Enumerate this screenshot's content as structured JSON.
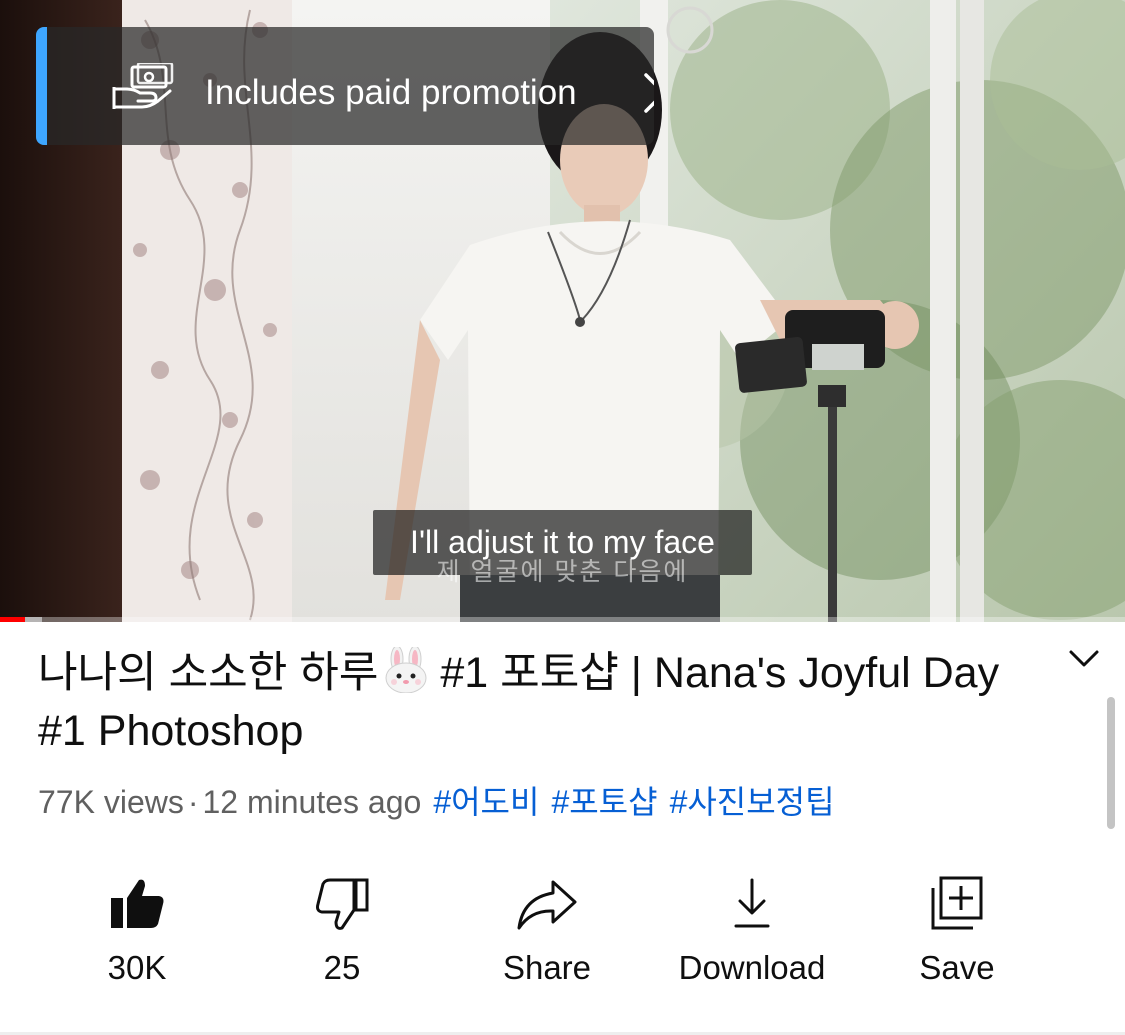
{
  "player": {
    "promo_label": "Includes paid promotion",
    "caption_en": "I'll adjust it to my face",
    "caption_burned": "제 얼굴에 맞춘 다음에",
    "progress": 0.022,
    "buffered": 0.037,
    "progress_color": "#ff0000",
    "promo_accent_color": "#3ea6ff"
  },
  "video": {
    "title_part1": "나나의 소소한 하루",
    "title_emoji": "rabbit-face-icon",
    "title_part2": "#1 포토샵 | Nana's Joyful Day #1 Photoshop",
    "views": "77K views",
    "separator": "·",
    "age": "12 minutes ago",
    "hashtags": [
      "#어도비",
      "#포토샵",
      "#사진보정팁"
    ],
    "hashtag_color": "#065fd4"
  },
  "actions": [
    {
      "icon": "thumbs-up-filled-icon",
      "label": "30K"
    },
    {
      "icon": "thumbs-down-icon",
      "label": "25"
    },
    {
      "icon": "share-arrow-icon",
      "label": "Share"
    },
    {
      "icon": "download-icon",
      "label": "Download"
    },
    {
      "icon": "save-playlist-icon",
      "label": "Save"
    }
  ]
}
